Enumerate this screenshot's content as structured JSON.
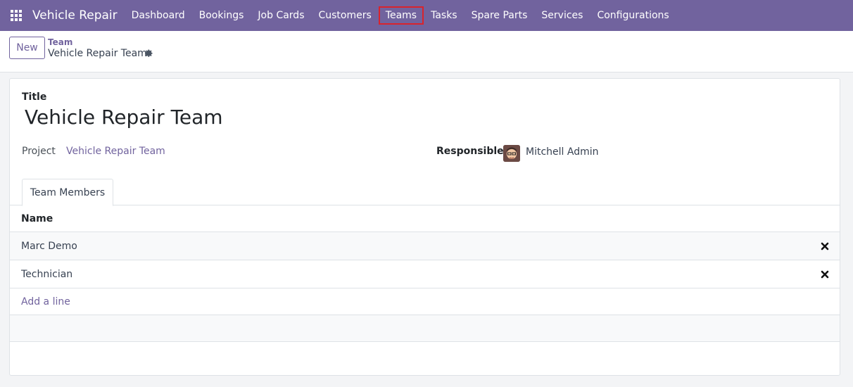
{
  "navbar": {
    "brand": "Vehicle Repair",
    "items": [
      {
        "label": "Dashboard"
      },
      {
        "label": "Bookings"
      },
      {
        "label": "Job Cards"
      },
      {
        "label": "Customers"
      },
      {
        "label": "Teams",
        "active": true
      },
      {
        "label": "Tasks"
      },
      {
        "label": "Spare Parts"
      },
      {
        "label": "Services"
      },
      {
        "label": "Configurations"
      }
    ]
  },
  "control_panel": {
    "new_label": "New",
    "breadcrumb": "Team",
    "record_title": "Vehicle Repair Team"
  },
  "form": {
    "title_label": "Title",
    "title_value": "Vehicle Repair Team",
    "project_label": "Project",
    "project_value": "Vehicle Repair Team",
    "responsible_label": "Responsible",
    "responsible_value": "Mitchell Admin"
  },
  "tabs": [
    {
      "label": "Team Members"
    }
  ],
  "members_table": {
    "header": "Name",
    "rows": [
      {
        "name": "Marc Demo"
      },
      {
        "name": "Technician"
      }
    ],
    "add_line": "Add a line"
  },
  "colors": {
    "brand": "#71639e",
    "active_outline": "#d9232d"
  }
}
